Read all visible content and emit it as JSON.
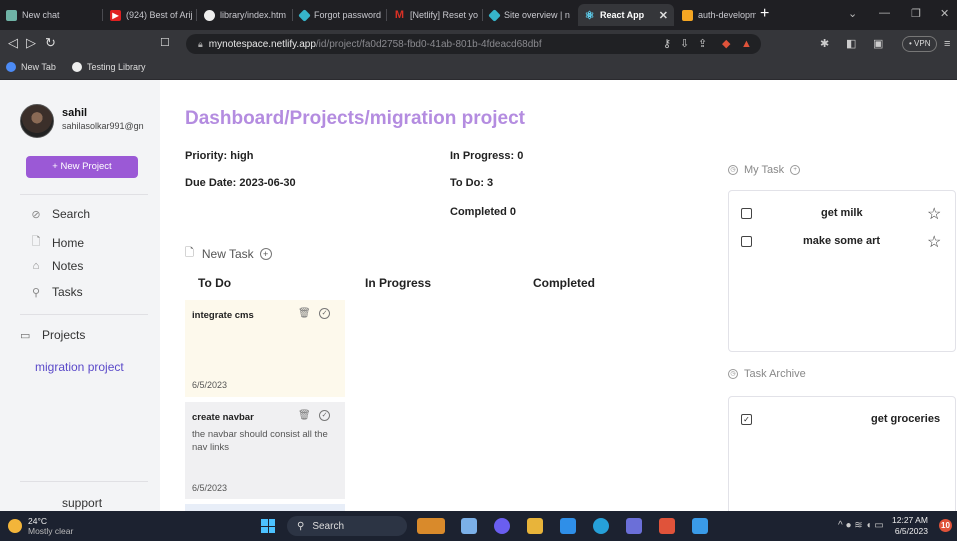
{
  "browser": {
    "tabs": [
      {
        "title": "New chat",
        "favicon_color": "#6fb3a6"
      },
      {
        "title": "(924) Best of Arij",
        "favicon_color": "#e02020"
      },
      {
        "title": "library/index.htm",
        "favicon_color": "#eeeeee"
      },
      {
        "title": "Forgot password",
        "favicon_color": "#36b3c9"
      },
      {
        "title": "[Netlify] Reset yo",
        "favicon_color": "#d93025"
      },
      {
        "title": "Site overview | n",
        "favicon_color": "#36b3c9"
      },
      {
        "title": "React App",
        "favicon_color": "#61dafb"
      },
      {
        "title": "auth-developme",
        "favicon_color": "#f5a623"
      }
    ],
    "active_tab_index": 6,
    "url_host": "mynotespace.netlify.app",
    "url_path": "/id/project/fa0d2758-fbd0-41ab-801b-4fdeacd68dbf",
    "vpn_label": "• VPN",
    "bookmarks": [
      "New Tab",
      "Testing Library"
    ]
  },
  "user": {
    "name": "sahil",
    "email": "sahilasolkar991@gn"
  },
  "sidebar": {
    "new_project_label": "+ New Project",
    "items": [
      {
        "label": "Search",
        "icon": "search-circle-icon"
      },
      {
        "label": "Home",
        "icon": "home-doc-icon"
      },
      {
        "label": "Notes",
        "icon": "notes-house-icon"
      },
      {
        "label": "Tasks",
        "icon": "tasks-magnifier-icon"
      }
    ],
    "projects_label": "Projects",
    "project_items": [
      "migration project"
    ],
    "support_label": "support"
  },
  "main": {
    "title": "Dashboard/Projects/migration project",
    "priority": "Priority: high",
    "due_date": "Due Date: 2023-06-30",
    "in_progress": "In Progress: 0",
    "to_do": "To Do: 3",
    "completed": "Completed 0",
    "new_task_label": "New Task",
    "columns": [
      "To Do",
      "In Progress",
      "Completed"
    ],
    "tasks": [
      {
        "title": "integrate cms",
        "description": "",
        "date": "6/5/2023",
        "bg": "#fdf9ec"
      },
      {
        "title": "create navbar",
        "description": "the navbar should consist all the nav links",
        "date": "6/5/2023",
        "bg": "#f0f0f2"
      }
    ]
  },
  "my_task": {
    "label": "My Task",
    "items": [
      {
        "text": "get milk",
        "checked": false
      },
      {
        "text": "make some art",
        "checked": false
      }
    ]
  },
  "task_archive": {
    "label": "Task Archive",
    "items": [
      {
        "text": "get groceries",
        "checked": true
      }
    ]
  },
  "taskbar": {
    "temperature": "24°C",
    "weather": "Mostly clear",
    "search_label": "Search",
    "time": "12:27 AM",
    "date": "6/5/2023",
    "notification_count": "10"
  },
  "colors": {
    "accent": "#9b59d6",
    "title": "#b48ce0",
    "link": "#5a49c9"
  }
}
